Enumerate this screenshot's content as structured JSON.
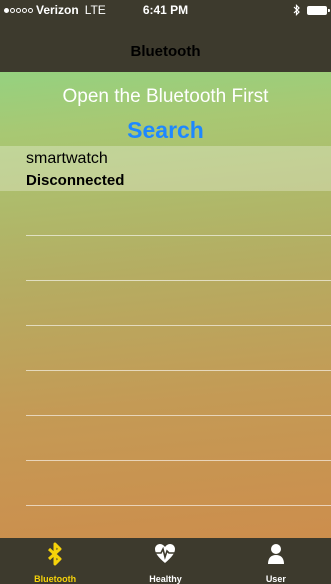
{
  "status_bar": {
    "carrier": "Verizon",
    "network": "LTE",
    "time": "6:41 PM"
  },
  "nav": {
    "title": "Bluetooth"
  },
  "prompt": "Open the Bluetooth First",
  "search_label": "Search",
  "devices": [
    {
      "name": "smartwatch",
      "status": "Disconnected"
    }
  ],
  "tabs": [
    {
      "label": "Bluetooth",
      "icon": "bluetooth-icon",
      "active": true
    },
    {
      "label": "Healthy",
      "icon": "heart-icon",
      "active": false
    },
    {
      "label": "User",
      "icon": "user-icon",
      "active": false
    }
  ],
  "colors": {
    "bar_background": "#3d3a2d",
    "accent_blue": "#1e88ff",
    "active_tab": "#f5d20a"
  }
}
